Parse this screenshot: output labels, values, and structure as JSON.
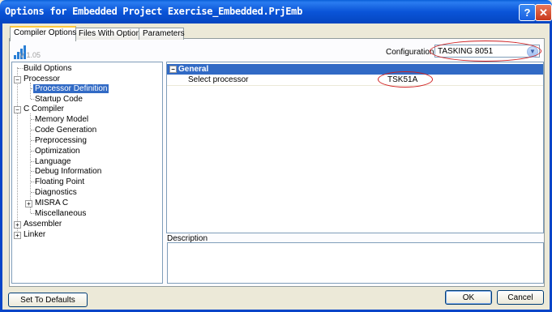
{
  "window": {
    "title": "Options for Embedded Project Exercise_Embedded.PrjEmb"
  },
  "tabs": [
    "Compiler Options",
    "Files With Options",
    "Parameters"
  ],
  "version": "V 1.05",
  "configuration": {
    "label": "Configuration",
    "value": "TASKING 8051"
  },
  "tree": {
    "items": [
      {
        "label": "Build Options"
      },
      {
        "label": "Processor",
        "expanded": true
      },
      {
        "label": "Processor Definition",
        "selected": true
      },
      {
        "label": "Startup Code"
      },
      {
        "label": "C Compiler",
        "expanded": true
      },
      {
        "label": "Memory Model"
      },
      {
        "label": "Code Generation"
      },
      {
        "label": "Preprocessing"
      },
      {
        "label": "Optimization"
      },
      {
        "label": "Language"
      },
      {
        "label": "Debug Information"
      },
      {
        "label": "Floating Point"
      },
      {
        "label": "Diagnostics"
      },
      {
        "label": "MISRA C",
        "expanded": false
      },
      {
        "label": "Miscellaneous"
      },
      {
        "label": "Assembler",
        "expanded": false
      },
      {
        "label": "Linker",
        "expanded": false
      }
    ]
  },
  "properties": {
    "category": "General",
    "rows": [
      {
        "key": "Select processor",
        "value": "TSK51A"
      }
    ]
  },
  "description": {
    "label": "Description",
    "text": ""
  },
  "buttons": {
    "defaults": "Set To Defaults",
    "ok": "OK",
    "cancel": "Cancel"
  },
  "colors": {
    "selection": "#316ac5",
    "title_bar": "#0a54d8",
    "annotation": "#d02020"
  }
}
